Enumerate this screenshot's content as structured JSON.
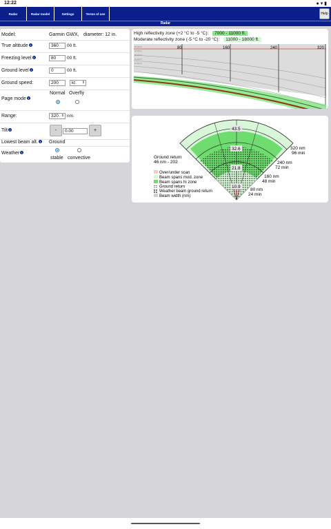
{
  "statusbar": {
    "time": "12:22",
    "icons": "●  ▾  ▮"
  },
  "nav": {
    "tabs": [
      {
        "label": "Radar"
      },
      {
        "label": "Radar model"
      },
      {
        "label": "Settings"
      },
      {
        "label": "Terms of use"
      }
    ],
    "help": "Help"
  },
  "page_title": "Radar",
  "form": {
    "model_label": "Model:",
    "model_value": "Garmin GWX,",
    "diameter_text": "diameter: 12 in.",
    "true_altitude_label": "True altitude",
    "true_altitude_value": "360",
    "true_altitude_unit": "00 ft.",
    "freezing_level_label": "Freezing level",
    "freezing_level_value": "80",
    "freezing_level_unit": "00 ft.",
    "ground_level_label": "Ground level",
    "ground_level_value": "0",
    "ground_level_unit": "00 ft.",
    "ground_speed_label": "Ground speed:",
    "ground_speed_value": "200",
    "ground_speed_unit": "kt",
    "page_mode_label": "Page mode",
    "page_mode_normal": "Normal",
    "page_mode_overfly": "Overfly",
    "range_label": "Range:",
    "range_value": "320",
    "range_unit": "nm.",
    "tilt_label": "Tilt",
    "tilt_minus": "-",
    "tilt_value": "0.00",
    "tilt_plus": "+",
    "lowest_beam_label": "Lowest beam alt.",
    "lowest_beam_value": "Ground",
    "weather_label": "Weather",
    "weather_stable": "stable",
    "weather_convective": "convective"
  },
  "elevation": {
    "high_zone_label": "High reflectivity zone (+2 °C to -5 °C):",
    "high_zone_value": "7000 - 11000 ft.",
    "moderate_zone_label": "Moderate reflectivity zone (-5 °C to -20 °C):",
    "moderate_zone_value": "11000 - 18000 ft.",
    "range_ticks": [
      "80",
      "160",
      "240",
      "320"
    ],
    "alt_ticks": [
      "50,000 ft",
      "40,000 ft",
      "30,000 ft",
      "20,000 ft",
      "10,000 ft"
    ],
    "colors": {
      "high": "#9be89b",
      "moderate": "#d8f7d8",
      "ground": "#8a3a10",
      "beam": "#c8c8c8"
    }
  },
  "plan": {
    "ground_return_title": "Ground return",
    "ground_return_value": "46 nm - 202",
    "ring_values": [
      "43.5",
      "32.6",
      "21.8",
      "10.9"
    ],
    "range_labels": [
      {
        "nm": "320 nm",
        "min": "96 min"
      },
      {
        "nm": "240 nm",
        "min": "72 min"
      },
      {
        "nm": "160 nm",
        "min": "48 min"
      },
      {
        "nm": "80 nm",
        "min": "24 min"
      }
    ],
    "legend": [
      {
        "label": "Over/under scan",
        "color": "#f6c8c8"
      },
      {
        "label": "Beam spans mod. zone",
        "color": "#d8f7d8"
      },
      {
        "label": "Beam spans hi zone",
        "color": "#6fdc6f"
      },
      {
        "label": "Ground return",
        "color": "#000000"
      },
      {
        "label": "Weather beam ground return",
        "color": "#000000"
      },
      {
        "label": "Beam width (nm)",
        "color": "#e6e6e6"
      }
    ]
  }
}
